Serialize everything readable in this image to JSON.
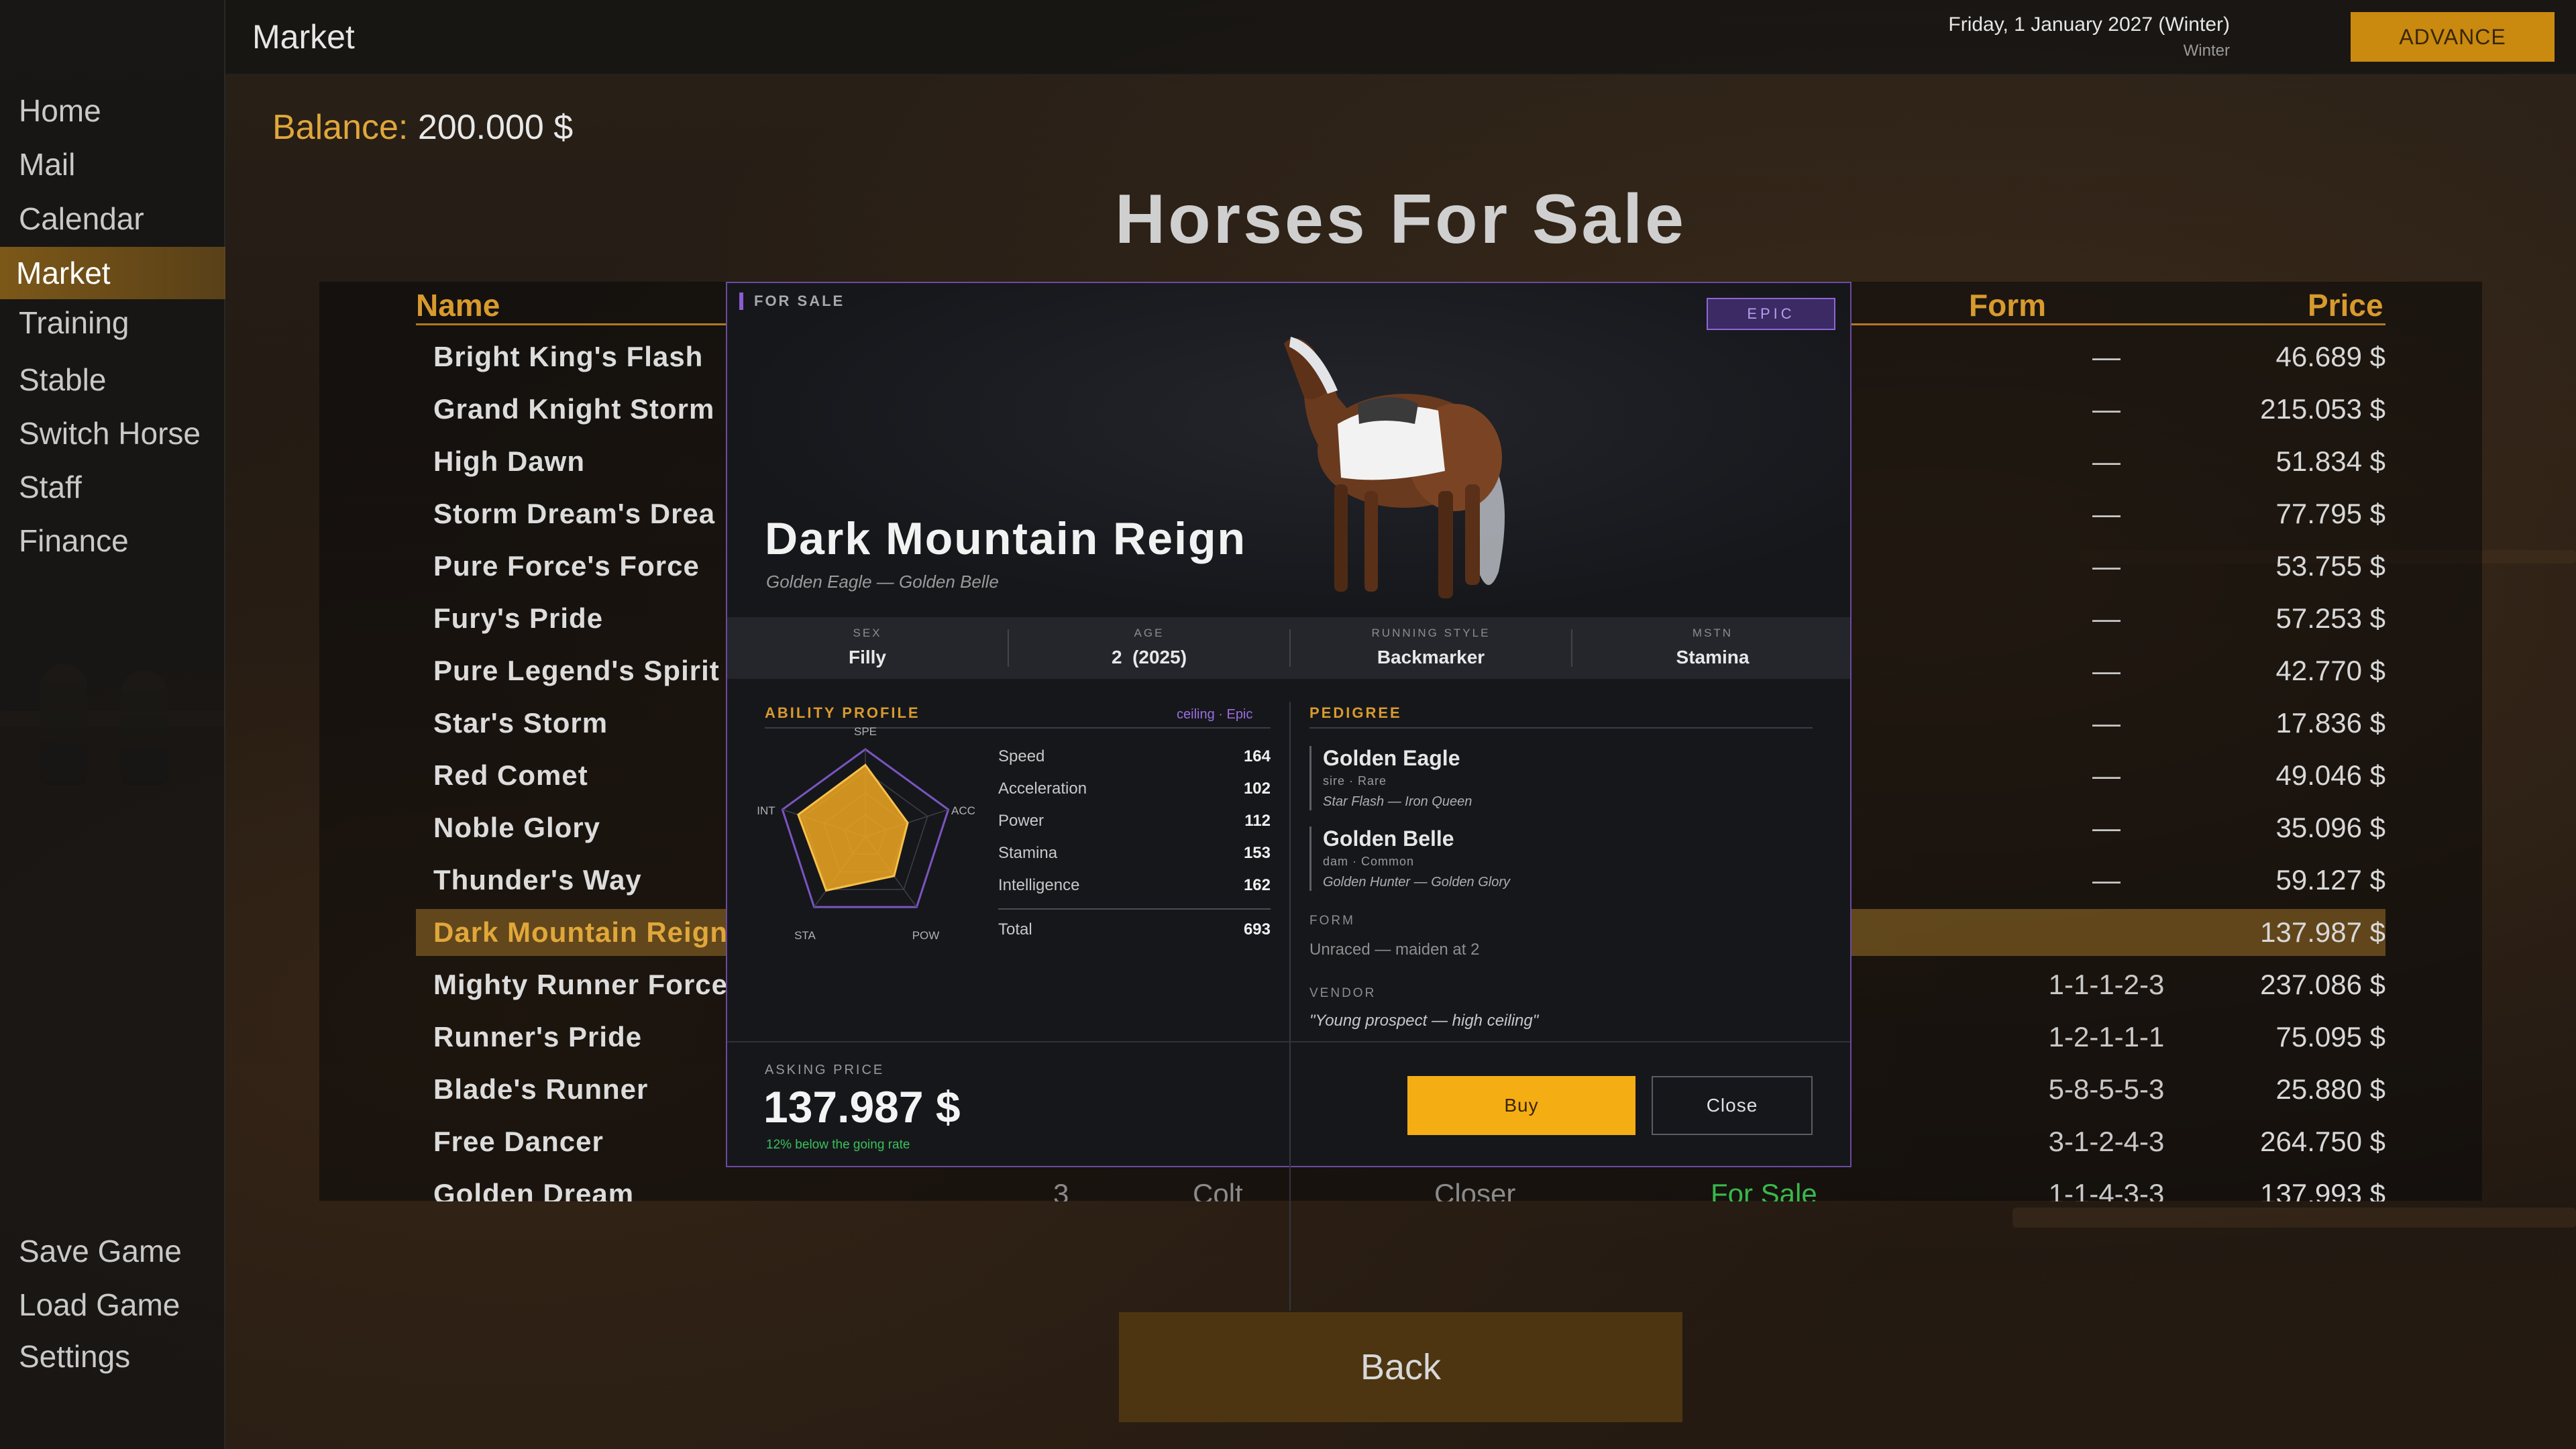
{
  "topbar": {
    "screen_title": "Market",
    "date": "Friday, 1 January 2027 (Winter)",
    "season": "Winter",
    "advance_label": "ADVANCE"
  },
  "sidebar": {
    "items": [
      {
        "label": "Home"
      },
      {
        "label": "Mail"
      },
      {
        "label": "Calendar"
      },
      {
        "label": "Market"
      },
      {
        "label": "Training"
      },
      {
        "label": "Stable"
      },
      {
        "label": "Switch Horse"
      },
      {
        "label": "Staff"
      },
      {
        "label": "Finance"
      }
    ],
    "active": "Market",
    "bottom": [
      {
        "label": "Save Game"
      },
      {
        "label": "Load Game"
      },
      {
        "label": "Settings"
      }
    ]
  },
  "balance": {
    "label": "Balance:",
    "value": "200.000 $"
  },
  "page_title": "Horses For Sale",
  "table": {
    "headers": {
      "name": "Name",
      "form": "Form",
      "price": "Price"
    },
    "rows": [
      {
        "name": "Bright King's Flash",
        "form": "—",
        "price": "46.689 $"
      },
      {
        "name": "Grand Knight Storm",
        "form": "—",
        "price": "215.053 $"
      },
      {
        "name": "High Dawn",
        "form": "—",
        "price": "51.834 $"
      },
      {
        "name": "Storm Dream's Drea",
        "form": "—",
        "price": "77.795 $"
      },
      {
        "name": "Pure Force's Force",
        "form": "—",
        "price": "53.755 $"
      },
      {
        "name": "Fury's Pride",
        "form": "—",
        "price": "57.253 $"
      },
      {
        "name": "Pure Legend's Spirit",
        "form": "—",
        "price": "42.770 $"
      },
      {
        "name": "Star's Storm",
        "form": "—",
        "price": "17.836 $"
      },
      {
        "name": "Red Comet",
        "form": "—",
        "price": "49.046 $"
      },
      {
        "name": "Noble Glory",
        "form": "—",
        "price": "35.096 $"
      },
      {
        "name": "Thunder's Way",
        "form": "—",
        "price": "59.127 $"
      },
      {
        "name": "Dark Mountain Reign",
        "form": "",
        "price": "137.987 $"
      },
      {
        "name": "Mighty Runner Force",
        "form": "1-1-1-2-3",
        "price": "237.086 $"
      },
      {
        "name": "Runner's Pride",
        "form": "1-2-1-1-1",
        "price": "75.095 $"
      },
      {
        "name": "Blade's Runner",
        "form": "5-8-5-5-3",
        "price": "25.880 $"
      },
      {
        "name": "Free Dancer",
        "form": "3-1-2-4-3",
        "price": "264.750 $"
      },
      {
        "name": "Golden Dream",
        "age": "3",
        "sex": "Colt",
        "style": "Closer",
        "status": "For Sale",
        "form": "1-1-4-3-3",
        "price": "137.993 $"
      }
    ],
    "selected_index": 11
  },
  "back_label": "Back",
  "modal": {
    "for_sale_label": "FOR SALE",
    "rarity": "EPIC",
    "horse_name": "Dark Mountain Reign",
    "parents_line": "Golden Eagle — Golden Belle",
    "info": [
      {
        "key": "SEX",
        "value": "Filly"
      },
      {
        "key": "AGE",
        "value": "2  (2025)"
      },
      {
        "key": "RUNNING STYLE",
        "value": "Backmarker"
      },
      {
        "key": "MSTN",
        "value": "Stamina"
      }
    ],
    "ability": {
      "title": "ABILITY PROFILE",
      "ceiling": "ceiling · Epic",
      "axes": [
        "SPE",
        "ACC",
        "POW",
        "STA",
        "INT"
      ],
      "stats": [
        {
          "name": "Speed",
          "value": 164
        },
        {
          "name": "Acceleration",
          "value": 102
        },
        {
          "name": "Power",
          "value": 112
        },
        {
          "name": "Stamina",
          "value": 153
        },
        {
          "name": "Intelligence",
          "value": 162
        }
      ],
      "total_label": "Total",
      "total": 693
    },
    "pedigree": {
      "title": "PEDIGREE",
      "sire": {
        "name": "Golden Eagle",
        "meta": "sire · Rare",
        "parents": "Star Flash — Iron Queen"
      },
      "dam": {
        "name": "Golden Belle",
        "meta": "dam · Common",
        "parents": "Golden Hunter — Golden Glory"
      }
    },
    "form_label": "FORM",
    "form_text": "Unraced — maiden at 2",
    "vendor_label": "VENDOR",
    "vendor_text": "\"Young prospect — high ceiling\"",
    "asking_label": "ASKING PRICE",
    "asking_price": "137.987 $",
    "asking_note": "12% below the going rate",
    "buy_label": "Buy",
    "close_label": "Close"
  },
  "colors": {
    "accent_gold": "#d89a2e",
    "highlight_row": "#6e501e",
    "epic_purple": "#8e66d8",
    "buy_button": "#f5ad14",
    "for_sale_green": "#39b84a"
  }
}
